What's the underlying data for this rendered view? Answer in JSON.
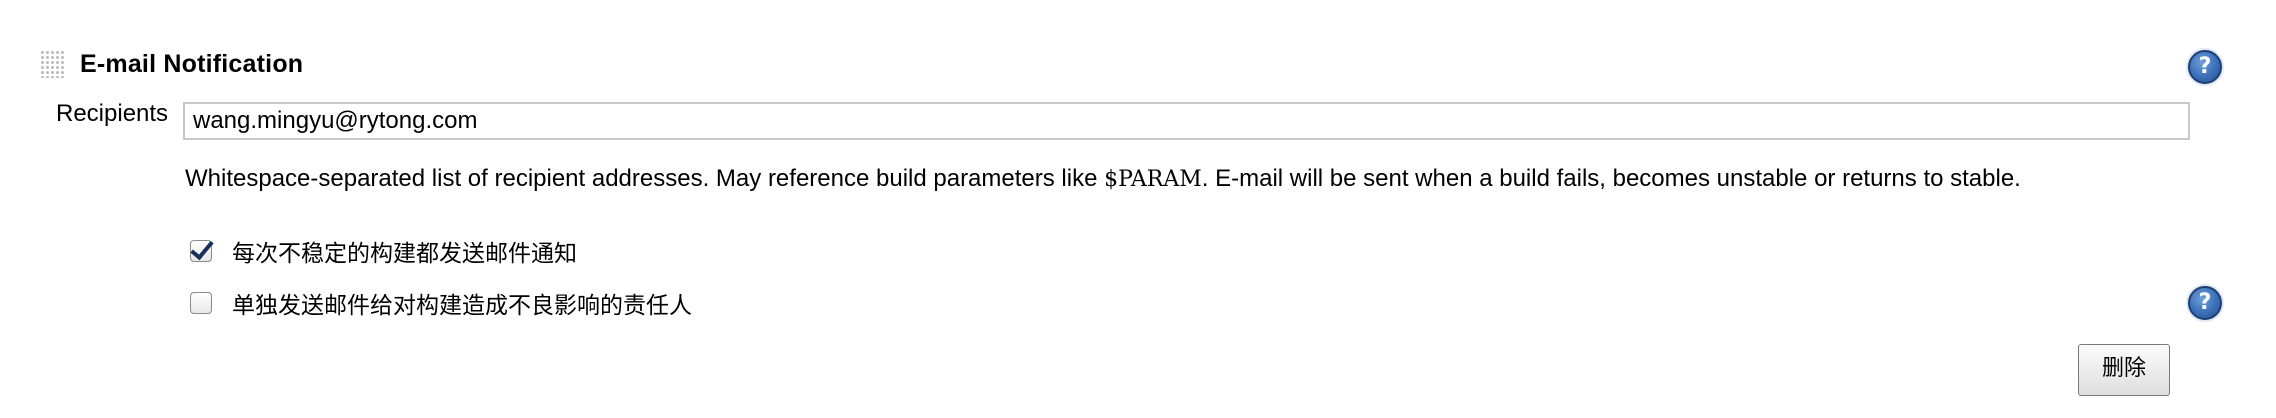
{
  "section": {
    "title": "E-mail Notification"
  },
  "recipients": {
    "label": "Recipients",
    "value": "wang.mingyu@rytong.com"
  },
  "description": {
    "before_code": "Whitespace-separated list of recipient addresses. May reference build parameters like ",
    "code": "$PARAM",
    "after_code": ". E-mail will be sent when a build fails, becomes unstable or returns to stable."
  },
  "options": [
    {
      "label": "每次不稳定的构建都发送邮件通知",
      "checked": true
    },
    {
      "label": "单独发送邮件给对构建造成不良影响的责任人",
      "checked": false
    }
  ],
  "help": {
    "symbol": "?"
  },
  "buttons": {
    "delete_label": "删除"
  },
  "icons": {
    "drag": "drag-handle-icon",
    "help": "help-icon",
    "check": "checkmark-icon"
  }
}
